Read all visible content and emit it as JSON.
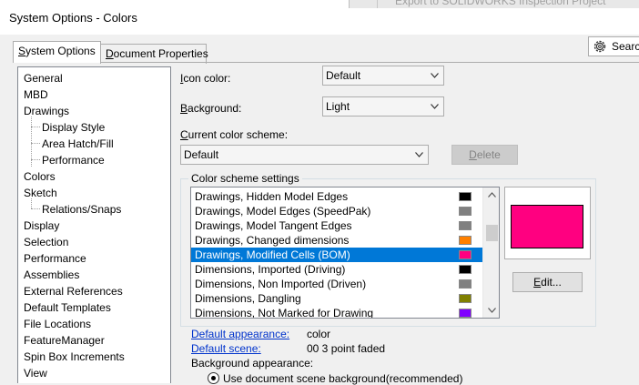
{
  "window": {
    "title": "System Options - Colors",
    "bg_text": "Export to SOLIDWORKS Inspection Project"
  },
  "tabs": {
    "system": {
      "pre": "",
      "key": "S",
      "post": "ystem Options"
    },
    "document": {
      "pre": "",
      "key": "D",
      "post": "ocument Properties"
    }
  },
  "search": {
    "label": "Search"
  },
  "tree": {
    "items": [
      "General",
      "MBD",
      "Drawings",
      "Display Style",
      "Area Hatch/Fill",
      "Performance",
      "Colors",
      "Sketch",
      "Relations/Snaps",
      "Display",
      "Selection",
      "Performance",
      "Assemblies",
      "External References",
      "Default Templates",
      "File Locations",
      "FeatureManager",
      "Spin Box Increments",
      "View"
    ]
  },
  "fields": {
    "icon_color": {
      "key": "I",
      "post": "con color:",
      "value": "Default"
    },
    "background": {
      "key": "B",
      "post": "ackground:",
      "value": "Light"
    },
    "scheme": {
      "key": "C",
      "post": "urrent color scheme:",
      "value": "Default"
    }
  },
  "buttons": {
    "delete": {
      "key": "D",
      "post": "elete"
    },
    "edit": {
      "key": "E",
      "post": "dit..."
    }
  },
  "group": {
    "legend": "Color scheme settings"
  },
  "color_list": [
    {
      "label": "Drawings, Hidden Model Edges",
      "color": "#000000"
    },
    {
      "label": "Drawings, Model Edges (SpeedPak)",
      "color": "#808080"
    },
    {
      "label": "Drawings, Model Tangent Edges",
      "color": "#808080"
    },
    {
      "label": "Drawings, Changed dimensions",
      "color": "#ff8000"
    },
    {
      "label": "Drawings, Modified Cells (BOM)",
      "color": "#ff0080"
    },
    {
      "label": "Dimensions, Imported (Driving)",
      "color": "#000000"
    },
    {
      "label": "Dimensions, Non Imported (Driven)",
      "color": "#808080"
    },
    {
      "label": "Dimensions, Dangling",
      "color": "#808000"
    },
    {
      "label": "Dimensions, Not Marked for Drawing",
      "color": "#8000ff"
    }
  ],
  "selected_color": "#ff0080",
  "appearance": {
    "default_appearance_label": "Default appearance:",
    "default_appearance_value": "color",
    "default_scene_label": "Default scene:",
    "default_scene_value": "00 3 point faded",
    "background_appearance_label": "Background appearance:",
    "radio_label": "Use document scene background(recommended)"
  }
}
